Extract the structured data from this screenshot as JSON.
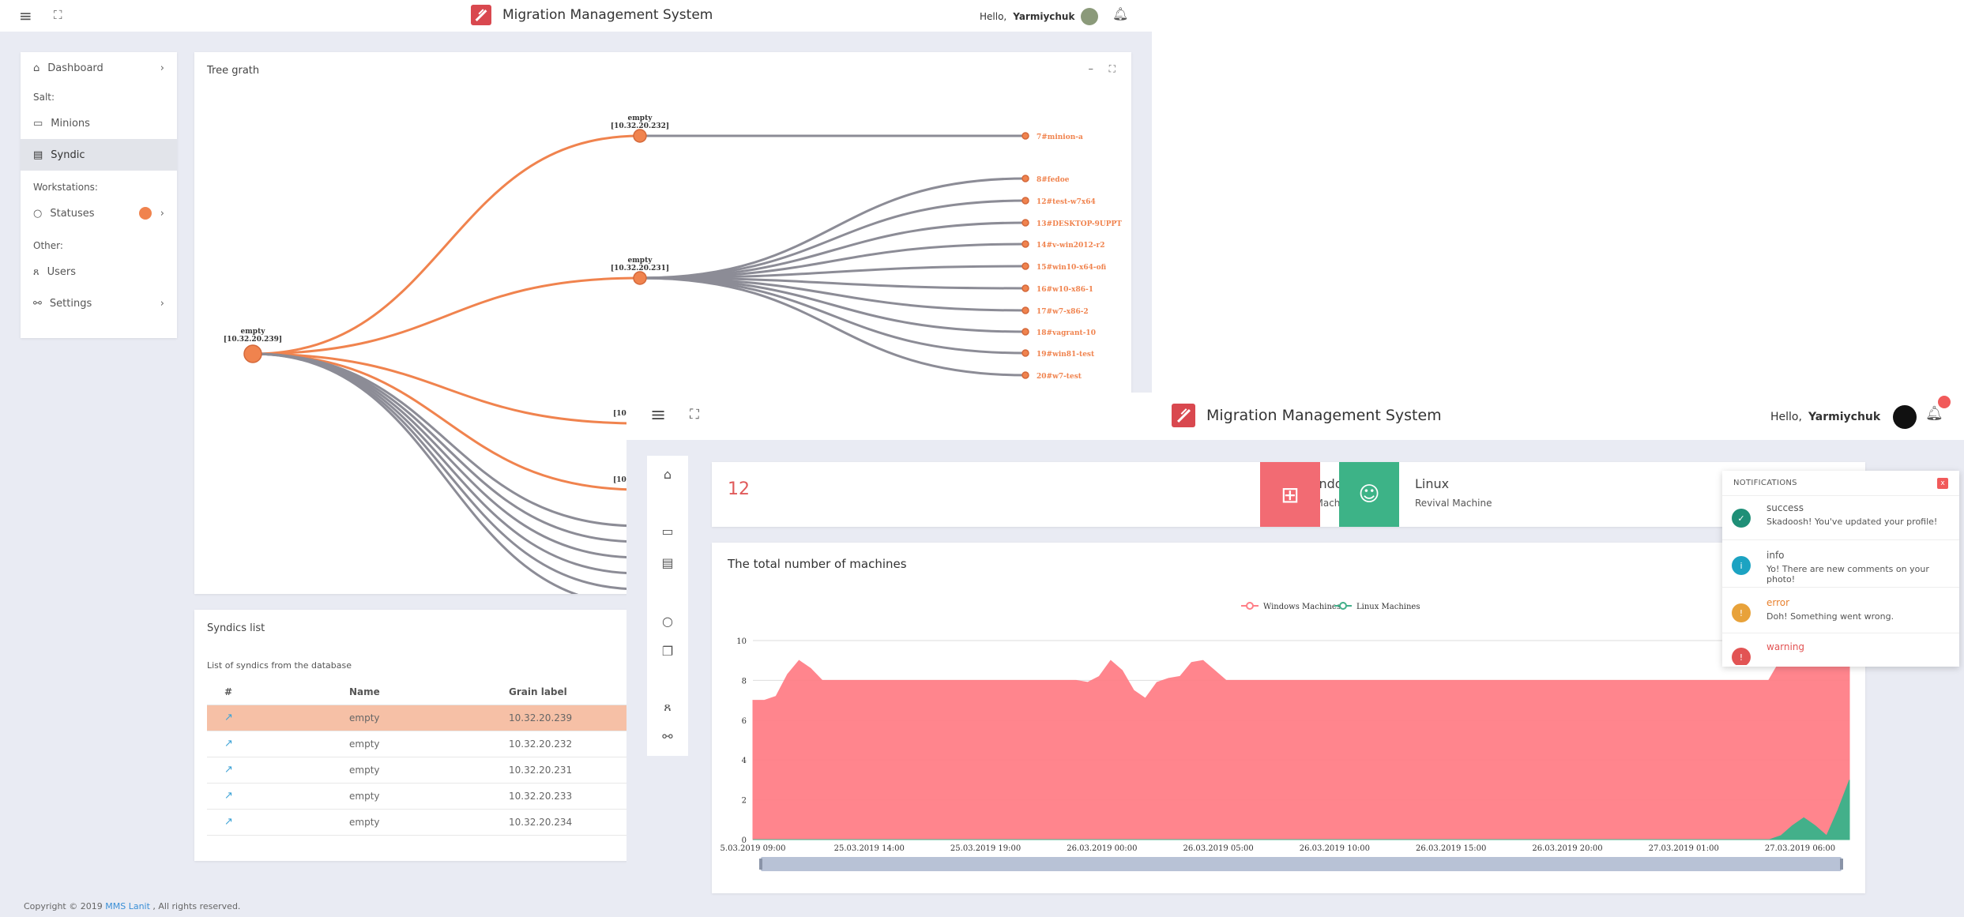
{
  "back": {
    "app_title": "Migration Management System",
    "greeting": "Hello,",
    "user_name": "Yarmiychuk",
    "sidebar": {
      "dashboard": "Dashboard",
      "sec_salt": "Salt:",
      "minions": "Minions",
      "syndic": "Syndic",
      "sec_workstations": "Workstations:",
      "statuses": "Statuses",
      "sec_other": "Other:",
      "users": "Users",
      "settings": "Settings"
    },
    "tree": {
      "title": "Tree grath",
      "minimize": "–",
      "root": {
        "label": "empty",
        "ip": "[10.32.20.239]"
      },
      "mid1": {
        "label": "empty",
        "ip": "[10.32.20.232]"
      },
      "mid2": {
        "label": "empty",
        "ip": "[10.32.20.231]"
      },
      "mid3_ip": "[10",
      "mid4_ip": "[10",
      "leaves": [
        "7#minion-a",
        "8#fedoe",
        "12#test-w7x64",
        "13#DESKTOP-9UPPT",
        "14#v-win2012-r2",
        "15#win10-x64-ofi",
        "16#w10-x86-1",
        "17#w7-x86-2",
        "18#vagrant-10",
        "19#win81-test",
        "20#w7-test"
      ]
    },
    "syndics": {
      "title": "Syndics list",
      "subtitle": "List of syndics from the database",
      "headers": [
        "#",
        "Name",
        "Grain label"
      ],
      "rows": [
        {
          "name": "empty",
          "grain": "10.32.20.239"
        },
        {
          "name": "empty",
          "grain": "10.32.20.232"
        },
        {
          "name": "empty",
          "grain": "10.32.20.231"
        },
        {
          "name": "empty",
          "grain": "10.32.20.233"
        },
        {
          "name": "empty",
          "grain": "10.32.20.234"
        }
      ]
    },
    "footer": {
      "prefix": "Copyright © 2019 ",
      "link": "MMS Lanit",
      "suffix": " , All rights reserved."
    }
  },
  "front": {
    "app_title": "Migration Management System",
    "greeting": "Hello,",
    "user_name": "Yarmiychuk",
    "count": "12",
    "windows": {
      "title": "Windows",
      "subtitle": "Doomed Machines"
    },
    "linux": {
      "title": "Linux",
      "subtitle": "Revival Machine"
    },
    "chart_title": "The total number of machines",
    "notifications": {
      "header": "NOTIFICATIONS",
      "close": "x",
      "items": [
        {
          "type": "success",
          "message": "Skadoosh! You've updated your profile!",
          "color": "#1f8f77"
        },
        {
          "type": "info",
          "message": "Yo! There are new comments on your photo!",
          "color": "#1ca3c2"
        },
        {
          "type": "error",
          "message": "Doh! Something went wrong.",
          "color": "#e8a23a"
        },
        {
          "type": "warning",
          "message": "",
          "color": "#e25454"
        }
      ]
    }
  },
  "colors": {
    "orange": "#f0834e",
    "windows": "#f26b73",
    "linux": "#3db387",
    "grey_link": "#8c8c96"
  },
  "chart_data": {
    "type": "area",
    "series": [
      {
        "name": "Windows Machines",
        "color": "#ff7f87",
        "values": [
          7,
          7,
          7.2,
          8.3,
          9,
          8.6,
          8,
          8,
          8,
          8,
          8,
          8,
          8,
          8,
          8,
          8,
          8,
          8,
          8,
          8,
          8,
          8,
          8,
          8,
          8,
          8,
          8,
          8,
          8,
          7.9,
          8.2,
          9,
          8.5,
          7.5,
          7.1,
          7.9,
          8.1,
          8.2,
          8.9,
          9,
          8.5,
          8,
          8,
          8,
          8,
          8,
          8,
          8,
          8,
          8,
          8,
          8,
          8,
          8,
          8,
          8,
          8,
          8,
          8,
          8,
          8,
          8,
          8,
          8,
          8,
          8,
          8,
          8,
          8,
          8,
          8,
          8,
          8,
          8,
          8,
          8,
          8,
          8,
          8,
          8,
          8,
          8,
          8,
          8,
          8,
          8,
          8,
          8,
          8,
          9,
          9,
          9,
          9,
          9,
          9,
          9
        ]
      },
      {
        "name": "Linux Machines",
        "color": "#43b08a",
        "values": [
          0,
          0,
          0,
          0,
          0,
          0,
          0,
          0,
          0,
          0,
          0,
          0,
          0,
          0,
          0,
          0,
          0,
          0,
          0,
          0,
          0,
          0,
          0,
          0,
          0,
          0,
          0,
          0,
          0,
          0,
          0,
          0,
          0,
          0,
          0,
          0,
          0,
          0,
          0,
          0,
          0,
          0,
          0,
          0,
          0,
          0,
          0,
          0,
          0,
          0,
          0,
          0,
          0,
          0,
          0,
          0,
          0,
          0,
          0,
          0,
          0,
          0,
          0,
          0,
          0,
          0,
          0,
          0,
          0,
          0,
          0,
          0,
          0,
          0,
          0,
          0,
          0,
          0,
          0,
          0,
          0,
          0,
          0,
          0,
          0,
          0,
          0,
          0,
          0,
          0,
          0.2,
          0.7,
          1.1,
          0.7,
          0.2,
          1.5,
          3
        ]
      }
    ],
    "x_ticks": [
      "5.03.2019 09:00",
      "25.03.2019 14:00",
      "25.03.2019 19:00",
      "26.03.2019 00:00",
      "26.03.2019 05:00",
      "26.03.2019 10:00",
      "26.03.2019 15:00",
      "26.03.2019 20:00",
      "27.03.2019 01:00",
      "27.03.2019 06:00"
    ],
    "y_ticks": [
      0,
      2,
      4,
      6,
      8,
      10
    ],
    "ylim": [
      0,
      10
    ],
    "legend": "top-center",
    "grid": true
  }
}
